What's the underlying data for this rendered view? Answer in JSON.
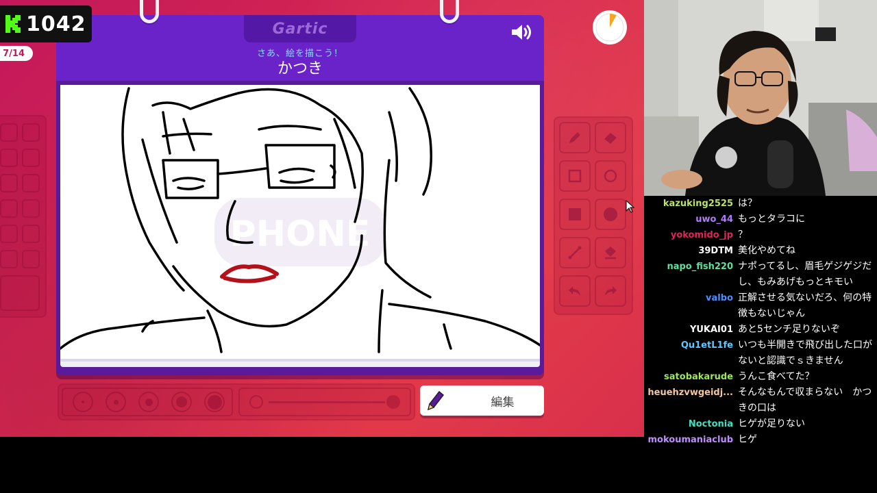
{
  "score": {
    "value": "1042"
  },
  "round": {
    "label": "7/14"
  },
  "header": {
    "logo": "Gartic",
    "instruction": "さあ、絵を描こう！",
    "player_name": "かつき"
  },
  "canvas": {
    "watermark": "PHONE"
  },
  "edit_button": {
    "label": "編集"
  },
  "timer": {
    "elapsed_fraction": 0.08
  },
  "colors": {
    "background": "#d8284f",
    "notebook": "#6a22c9",
    "instruction": "#7fe0ff",
    "lips": "#b3121a"
  },
  "tools": [
    "pencil-icon",
    "eraser-icon",
    "rectangle-outline-icon",
    "ellipse-outline-icon",
    "rectangle-fill-icon",
    "ellipse-fill-icon",
    "line-icon",
    "bucket-icon",
    "undo-icon",
    "redo-icon"
  ],
  "chat": [
    {
      "user": "kazuking2525",
      "text": "は？",
      "color": "#b9e26b"
    },
    {
      "user": "uwo_44",
      "text": "もっとタラコに",
      "color": "#b07cff"
    },
    {
      "user": "yokomido_jp",
      "text": "？",
      "color": "#e0245e"
    },
    {
      "user": "39DTM",
      "text": "美化やめてね",
      "color": "#ffffff"
    },
    {
      "user": "napo_fish220",
      "text": "ナポってるし、眉毛ゲジゲジだし、もみあげもっとキモい",
      "color": "#5ee0a0"
    },
    {
      "user": "valbo",
      "text": "正解させる気ないだろ、何の特徴もないじゃん",
      "color": "#4d8fff"
    },
    {
      "user": "YUKAI01",
      "text": "あと5センチ足りないぞ",
      "color": "#ffffff"
    },
    {
      "user": "Qu1etL1fe",
      "text": "いつも半開きで飛び出した口がないと認識でｓきません",
      "color": "#5ec8ff"
    },
    {
      "user": "satobakarude",
      "text": "うんこ食べてた？",
      "color": "#9be85a"
    },
    {
      "user": "heuehzvwgeidj...",
      "text": "そんなもんで収まらない　かつきの口は",
      "color": "#f5c7a0"
    },
    {
      "user": "Noctonia",
      "text": "ヒゲが足りない",
      "color": "#40e0c0"
    },
    {
      "user": "mokoumaniaclub",
      "text": "ヒゲ",
      "color": "#c08cff"
    }
  ]
}
